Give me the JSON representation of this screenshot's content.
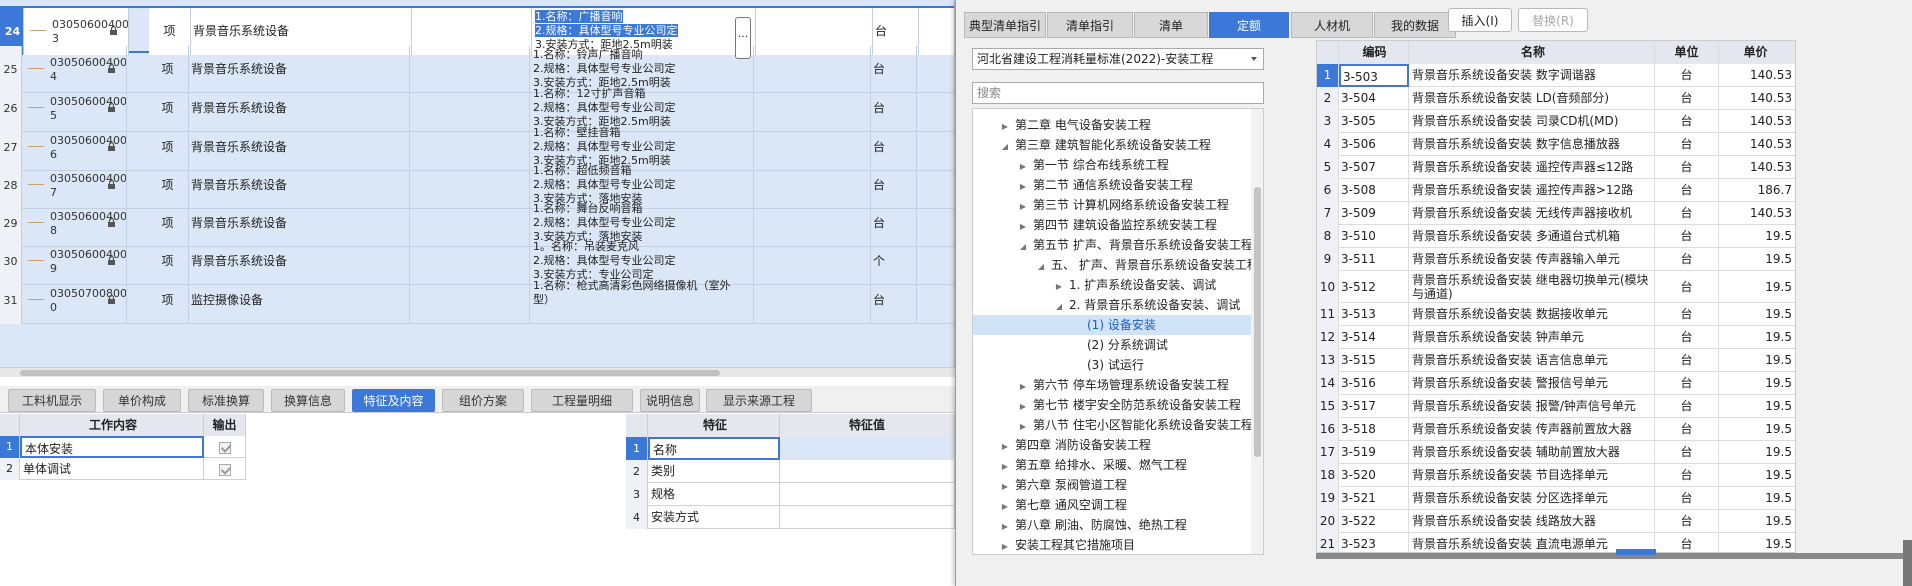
{
  "bill_rows": [
    {
      "num": "24",
      "code": [
        "03050600400",
        "3"
      ],
      "type": "项",
      "name": "背景音乐系统设备",
      "feat": [
        "1.名称：广播音响",
        "2.规格：具体型号专业公司定",
        "3.安装方式：距地2.5m明装"
      ],
      "unit": "台",
      "selected": true
    },
    {
      "num": "25",
      "code": [
        "03050600400",
        "4"
      ],
      "type": "项",
      "name": "背景音乐系统设备",
      "feat": [
        "1.名称：铃声广播音响",
        "2.规格：具体型号专业公司定",
        "3.安装方式：距地2.5m明装"
      ],
      "unit": "台"
    },
    {
      "num": "26",
      "code": [
        "03050600400",
        "5"
      ],
      "type": "项",
      "name": "背景音乐系统设备",
      "feat": [
        "1.名称：12寸扩声音箱",
        "2.规格：具体型号专业公司定",
        "3.安装方式：距地2.5m明装"
      ],
      "unit": "台"
    },
    {
      "num": "27",
      "code": [
        "03050600400",
        "6"
      ],
      "type": "项",
      "name": "背景音乐系统设备",
      "feat": [
        "1.名称：壁挂音箱",
        "2.规格：具体型号专业公司定",
        "3.安装方式：距地2.5m明装"
      ],
      "unit": "台"
    },
    {
      "num": "28",
      "code": [
        "03050600400",
        "7"
      ],
      "type": "项",
      "name": "背景音乐系统设备",
      "feat": [
        "1.名称：超低频音箱",
        "2.规格：具体型号专业公司定",
        "3.安装方式：落地安装"
      ],
      "unit": "台"
    },
    {
      "num": "29",
      "code": [
        "03050600400",
        "8"
      ],
      "type": "项",
      "name": "背景音乐系统设备",
      "feat": [
        "1.名称：舞台反响音箱",
        "2.规格：具体型号专业公司定",
        "3.安装方式：落地安装"
      ],
      "unit": "台"
    },
    {
      "num": "30",
      "code": [
        "03050600400",
        "9"
      ],
      "type": "项",
      "name": "背景音乐系统设备",
      "feat": [
        "1。名称：吊装麦克风",
        "2.规格：具体型号专业公司定",
        "3.安装方式：专业公司定"
      ],
      "unit": "个"
    },
    {
      "num": "31",
      "code": [
        "03050700800",
        "0"
      ],
      "type": "项",
      "name": "监控摄像设备",
      "feat": [
        "1.名称：枪式高清彩色网络摄像机（室外",
        "型）",
        ""
      ],
      "unit": "台"
    }
  ],
  "bottom_tabs": [
    "工料机显示",
    "单价构成",
    "标准换算",
    "换算信息",
    "特征及内容",
    "组价方案",
    "工程量明细",
    "说明信息",
    "显示来源工程"
  ],
  "active_bottom_tab": "特征及内容",
  "work_table": {
    "headers": [
      "工作内容",
      "输出"
    ],
    "rows": [
      {
        "num": "1",
        "text": "本体安装"
      },
      {
        "num": "2",
        "text": "单体调试"
      }
    ]
  },
  "feature_table": {
    "headers": [
      "特征",
      "特征值"
    ],
    "rows": [
      {
        "num": "1",
        "text": "名称"
      },
      {
        "num": "2",
        "text": "类别"
      },
      {
        "num": "3",
        "text": "规格"
      },
      {
        "num": "4",
        "text": "安装方式"
      }
    ]
  },
  "quota_tabs": [
    "典型清单指引",
    "清单指引",
    "清单",
    "定额",
    "人材机",
    "我的数据"
  ],
  "active_quota_tab": "定额",
  "buttons": {
    "insert": "插入(I)",
    "replace": "替换(R)"
  },
  "standard": "河北省建设工程消耗量标准(2022)-安装工程",
  "search_placeholder": "搜索",
  "tree": [
    {
      "label": "第二章 电气设备安装工程",
      "level": 1,
      "arrow": "closed"
    },
    {
      "label": "第三章 建筑智能化系统设备安装工程",
      "level": 1,
      "arrow": "open"
    },
    {
      "label": "第一节 综合布线系统工程",
      "level": 2,
      "arrow": "closed"
    },
    {
      "label": "第二节 通信系统设备安装工程",
      "level": 2,
      "arrow": "closed"
    },
    {
      "label": "第三节 计算机网络系统设备安装工程",
      "level": 2,
      "arrow": "closed"
    },
    {
      "label": "第四节 建筑设备监控系统安装工程",
      "level": 2,
      "arrow": "closed"
    },
    {
      "label": "第五节 扩声、背景音乐系统设备安装工程",
      "level": 2,
      "arrow": "open"
    },
    {
      "label": "五、 扩声、背景音乐系统设备安装工程",
      "level": 3,
      "arrow": "open"
    },
    {
      "label": "1. 扩声系统设备安装、调试",
      "level": 4,
      "arrow": "closed"
    },
    {
      "label": "2. 背景音乐系统设备安装、调试",
      "level": 4,
      "arrow": "open"
    },
    {
      "label": "(1) 设备安装",
      "level": 5,
      "arrow": "none",
      "selected": true
    },
    {
      "label": "(2) 分系统调试",
      "level": 5,
      "arrow": "none"
    },
    {
      "label": "(3) 试运行",
      "level": 5,
      "arrow": "none"
    },
    {
      "label": "第六节 停车场管理系统设备安装工程",
      "level": 2,
      "arrow": "closed"
    },
    {
      "label": "第七节 楼宇安全防范系统设备安装工程",
      "level": 2,
      "arrow": "closed"
    },
    {
      "label": "第八节 住宅小区智能化系统设备安装工程",
      "level": 2,
      "arrow": "closed"
    },
    {
      "label": "第四章 消防设备安装工程",
      "level": 1,
      "arrow": "closed"
    },
    {
      "label": "第五章 给排水、采暖、燃气工程",
      "level": 1,
      "arrow": "closed"
    },
    {
      "label": "第六章 泵阀管道工程",
      "level": 1,
      "arrow": "closed"
    },
    {
      "label": "第七章 通风空调工程",
      "level": 1,
      "arrow": "closed"
    },
    {
      "label": "第八章 刷油、防腐蚀、绝热工程",
      "level": 1,
      "arrow": "closed"
    },
    {
      "label": "安装工程其它措施项目",
      "level": 1,
      "arrow": "closed"
    }
  ],
  "quota_grid": {
    "headers": [
      "编码",
      "名称",
      "单位",
      "单价"
    ],
    "rows": [
      {
        "num": "1",
        "code": "3-503",
        "name": "背景音乐系统设备安装 数字调谐器",
        "unit": "台",
        "price": "140.53",
        "selected": true
      },
      {
        "num": "2",
        "code": "3-504",
        "name": "背景音乐系统设备安装 LD(音频部分)",
        "unit": "台",
        "price": "140.53"
      },
      {
        "num": "3",
        "code": "3-505",
        "name": "背景音乐系统设备安装 司录CD机(MD)",
        "unit": "台",
        "price": "140.53"
      },
      {
        "num": "4",
        "code": "3-506",
        "name": "背景音乐系统设备安装 数字信息播放器",
        "unit": "台",
        "price": "140.53"
      },
      {
        "num": "5",
        "code": "3-507",
        "name": "背景音乐系统设备安装 遥控传声器≤12路",
        "unit": "台",
        "price": "140.53"
      },
      {
        "num": "6",
        "code": "3-508",
        "name": "背景音乐系统设备安装 遥控传声器>12路",
        "unit": "台",
        "price": "186.7"
      },
      {
        "num": "7",
        "code": "3-509",
        "name": "背景音乐系统设备安装 无线传声器接收机",
        "unit": "台",
        "price": "140.53"
      },
      {
        "num": "8",
        "code": "3-510",
        "name": "背景音乐系统设备安装 多通道台式机箱",
        "unit": "台",
        "price": "19.5"
      },
      {
        "num": "9",
        "code": "3-511",
        "name": "背景音乐系统设备安装 传声器输入单元",
        "unit": "台",
        "price": "19.5"
      },
      {
        "num": "10",
        "code": "3-512",
        "name": "背景音乐系统设备安装 继电器切换单元(模块与通道)",
        "unit": "台",
        "price": "19.5",
        "tall": true
      },
      {
        "num": "11",
        "code": "3-513",
        "name": "背景音乐系统设备安装 数据接收单元",
        "unit": "台",
        "price": "19.5"
      },
      {
        "num": "12",
        "code": "3-514",
        "name": "背景音乐系统设备安装 钟声单元",
        "unit": "台",
        "price": "19.5"
      },
      {
        "num": "13",
        "code": "3-515",
        "name": "背景音乐系统设备安装 语言信息单元",
        "unit": "台",
        "price": "19.5"
      },
      {
        "num": "14",
        "code": "3-516",
        "name": "背景音乐系统设备安装 警报信号单元",
        "unit": "台",
        "price": "19.5"
      },
      {
        "num": "15",
        "code": "3-517",
        "name": "背景音乐系统设备安装 报警/钟声信号单元",
        "unit": "台",
        "price": "19.5"
      },
      {
        "num": "16",
        "code": "3-518",
        "name": "背景音乐系统设备安装 传声器前置放大器",
        "unit": "台",
        "price": "19.5"
      },
      {
        "num": "17",
        "code": "3-519",
        "name": "背景音乐系统设备安装 辅助前置放大器",
        "unit": "台",
        "price": "19.5"
      },
      {
        "num": "18",
        "code": "3-520",
        "name": "背景音乐系统设备安装 节目选择单元",
        "unit": "台",
        "price": "19.5"
      },
      {
        "num": "19",
        "code": "3-521",
        "name": "背景音乐系统设备安装 分区选择单元",
        "unit": "台",
        "price": "19.5"
      },
      {
        "num": "20",
        "code": "3-522",
        "name": "背景音乐系统设备安装 线路放大器",
        "unit": "台",
        "price": "19.5"
      },
      {
        "num": "21",
        "code": "3-523",
        "name": "背景音乐系统设备安装 直流电源单元",
        "unit": "台",
        "price": "19.5"
      }
    ]
  },
  "colors": {
    "accent": "#3b78d8",
    "row_bg": "#dbe7f6"
  },
  "icons": {
    "lock": "lock-icon",
    "ellipsis": "ellipsis-icon",
    "dropdown": "chevron-down-icon"
  }
}
